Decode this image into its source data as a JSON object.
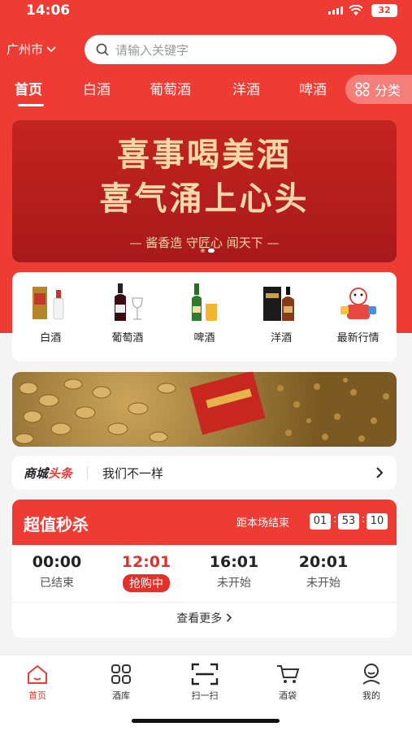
{
  "status_bar": {
    "time": "14:06",
    "battery": "32"
  },
  "location": {
    "city": "广州市"
  },
  "search": {
    "placeholder": "请输入关键字"
  },
  "tabs": [
    {
      "label": "首页",
      "active": true
    },
    {
      "label": "白酒"
    },
    {
      "label": "葡萄酒"
    },
    {
      "label": "洋酒"
    },
    {
      "label": "啤酒"
    }
  ],
  "category_button": {
    "label": "分类"
  },
  "banner": {
    "line1": "喜事喝美酒",
    "line2": "喜气涌上心头",
    "line3": "— 酱香造 守匠心 闻天下 —"
  },
  "categories": [
    {
      "label": "白酒",
      "icon": "baijiu-bottle-icon"
    },
    {
      "label": "葡萄酒",
      "icon": "wine-bottle-icon"
    },
    {
      "label": "啤酒",
      "icon": "beer-bottle-icon"
    },
    {
      "label": "洋酒",
      "icon": "cognac-bottle-icon"
    },
    {
      "label": "最新行情",
      "icon": "market-mascot-icon"
    }
  ],
  "headline": {
    "brand_prefix": "商城",
    "brand_suffix": "头条",
    "text": "我们不一样"
  },
  "flash_sale": {
    "title": "超值秒杀",
    "countdown_label": "距本场结束",
    "countdown": [
      "01",
      "53",
      "10"
    ],
    "slots": [
      {
        "time": "00:00",
        "status": "已结束"
      },
      {
        "time": "12:01",
        "status": "抢购中",
        "active": true
      },
      {
        "time": "16:01",
        "status": "未开始"
      },
      {
        "time": "20:01",
        "status": "未开始"
      }
    ],
    "more": "查看更多"
  },
  "bottom_nav": [
    {
      "label": "首页",
      "icon": "home-icon",
      "active": true
    },
    {
      "label": "酒库",
      "icon": "grid-icon"
    },
    {
      "label": "扫一扫",
      "icon": "scan-icon"
    },
    {
      "label": "酒袋",
      "icon": "cart-icon"
    },
    {
      "label": "我的",
      "icon": "profile-icon"
    }
  ],
  "colors": {
    "brand_red": "#ee3b34",
    "gold_text": "#f4d8a8"
  }
}
